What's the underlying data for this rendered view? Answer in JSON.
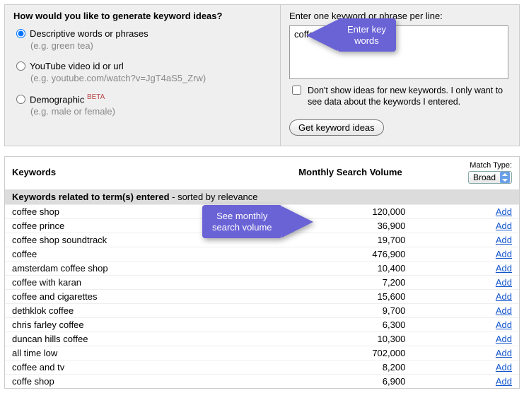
{
  "form": {
    "title": "How would you like to generate keyword ideas?",
    "options": {
      "descriptive": {
        "label": "Descriptive words or phrases",
        "hint": "(e.g. green tea)"
      },
      "youtube": {
        "label": "YouTube video id or url",
        "hint": "(e.g. youtube.com/watch?v=JgT4aS5_Zrw)"
      },
      "demo": {
        "label": "Demographic ",
        "beta": "BETA",
        "hint": "(e.g. male or female)"
      }
    },
    "right_label": "Enter one keyword or phrase per line:",
    "textarea_value": "coffee",
    "checkbox_label": "Don't show ideas for new keywords. I only want to see data about the keywords I entered.",
    "button": "Get keyword ideas"
  },
  "callouts": {
    "enter": "Enter key\nwords",
    "volume": "See monthly\nsearch volume"
  },
  "results": {
    "col_keywords": "Keywords",
    "col_volume": "Monthly Search Volume",
    "match_type_label": "Match Type:",
    "match_type_value": "Broad",
    "subheader_bold": "Keywords related to term(s) entered",
    "subheader_rest": " - sorted by relevance",
    "add_label": "Add",
    "rows": [
      {
        "k": "coffee shop",
        "v": "120,000"
      },
      {
        "k": "coffee prince",
        "v": "36,900"
      },
      {
        "k": "coffee shop soundtrack",
        "v": "19,700"
      },
      {
        "k": "coffee",
        "v": "476,900"
      },
      {
        "k": "amsterdam coffee shop",
        "v": "10,400"
      },
      {
        "k": "coffee with karan",
        "v": "7,200"
      },
      {
        "k": "coffee and cigarettes",
        "v": "15,600"
      },
      {
        "k": "dethklok coffee",
        "v": "9,700"
      },
      {
        "k": "chris farley coffee",
        "v": "6,300"
      },
      {
        "k": "duncan hills coffee",
        "v": "10,300"
      },
      {
        "k": "all time low",
        "v": "702,000"
      },
      {
        "k": "coffee and tv",
        "v": "8,200"
      },
      {
        "k": "coffe shop",
        "v": "6,900"
      }
    ]
  }
}
